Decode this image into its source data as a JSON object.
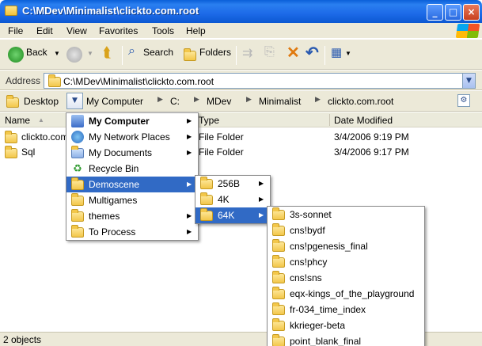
{
  "window": {
    "title": "C:\\MDev\\Minimalist\\clickto.com.root"
  },
  "menubar": {
    "items": [
      "File",
      "Edit",
      "View",
      "Favorites",
      "Tools",
      "Help"
    ]
  },
  "toolbar": {
    "back": "Back",
    "search": "Search",
    "folders": "Folders"
  },
  "address": {
    "label": "Address",
    "value": "C:\\MDev\\Minimalist\\clickto.com.root"
  },
  "breadcrumb": {
    "items": [
      "Desktop",
      "My Computer",
      "C:",
      "MDev",
      "Minimalist",
      "clickto.com.root"
    ]
  },
  "list": {
    "columns": [
      "Name",
      "Type",
      "Date Modified"
    ],
    "rows": [
      {
        "name": "clickto.com",
        "type": "File Folder",
        "date": "3/4/2006 9:19 PM"
      },
      {
        "name": "Sql",
        "type": "File Folder",
        "date": "3/4/2006 9:17 PM"
      }
    ]
  },
  "status": {
    "text": "2 objects"
  },
  "menu1": {
    "items": [
      {
        "label": "My Computer",
        "icon": "computer-icon",
        "bold": true,
        "submenu": true
      },
      {
        "label": "My Network Places",
        "icon": "network-icon",
        "submenu": true
      },
      {
        "label": "My Documents",
        "icon": "documents-icon",
        "submenu": true
      },
      {
        "label": "Recycle Bin",
        "icon": "recycle-bin-icon",
        "submenu": false
      },
      {
        "label": "Demoscene",
        "icon": "folder-icon",
        "submenu": true,
        "highlighted": true
      },
      {
        "label": "Multigames",
        "icon": "folder-icon",
        "submenu": false
      },
      {
        "label": "themes",
        "icon": "folder-icon",
        "submenu": true
      },
      {
        "label": "To Process",
        "icon": "folder-icon",
        "submenu": true
      }
    ]
  },
  "menu2": {
    "items": [
      {
        "label": "256B",
        "submenu": true
      },
      {
        "label": "4K",
        "submenu": true
      },
      {
        "label": "64K",
        "submenu": true,
        "highlighted": true
      }
    ]
  },
  "menu3": {
    "items": [
      "3s-sonnet",
      "cns!bydf",
      "cns!pgenesis_final",
      "cns!phcy",
      "cns!sns",
      "eqx-kings_of_the_playground",
      "fr-034_time_index",
      "kkrieger-beta",
      "point_blank_final"
    ]
  },
  "colors": {
    "highlight": "#316ac5",
    "titlebar": "#1d6ae8",
    "chrome": "#ece9d8"
  }
}
